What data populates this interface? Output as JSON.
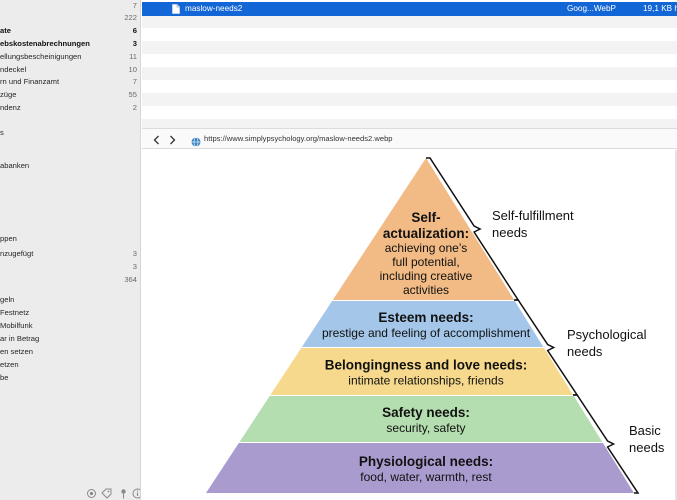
{
  "sidebar": {
    "items": [
      {
        "label": "",
        "count": "7",
        "bold": false
      },
      {
        "label": "",
        "count": "222",
        "bold": false
      },
      {
        "label": "ate",
        "count": "6",
        "bold": true
      },
      {
        "label": "ebskostenabrechnungen",
        "count": "3",
        "bold": true
      },
      {
        "label": "ellungsbescheinigungen",
        "count": "11",
        "bold": false
      },
      {
        "label": "ndeckel",
        "count": "10",
        "bold": false
      },
      {
        "label": "rn und Finanzamt",
        "count": "7",
        "bold": false
      },
      {
        "label": "züge",
        "count": "55",
        "bold": false
      },
      {
        "label": "ndenz",
        "count": "2",
        "bold": false
      },
      {
        "label": "",
        "count": "",
        "bold": false
      },
      {
        "label": "s",
        "count": "",
        "bold": false
      },
      {
        "label": "",
        "count": "",
        "bold": false
      },
      {
        "label": "",
        "count": "",
        "bold": false
      },
      {
        "label": "abanken",
        "count": "",
        "bold": false
      },
      {
        "label": "",
        "count": "",
        "bold": false
      },
      {
        "label": "",
        "count": "",
        "bold": false
      },
      {
        "label": "",
        "count": "",
        "bold": false
      },
      {
        "label": "",
        "count": "",
        "bold": false
      },
      {
        "label": "",
        "count": "",
        "bold": false
      },
      {
        "label": "ppen",
        "count": "",
        "bold": false
      },
      {
        "label": "nzugefügt",
        "count": "3",
        "bold": false
      },
      {
        "label": "",
        "count": "3",
        "bold": false
      },
      {
        "label": "",
        "count": "364",
        "bold": false
      },
      {
        "label": "",
        "count": "",
        "bold": false
      },
      {
        "label": "geln",
        "count": "",
        "bold": false
      },
      {
        "label": "Festnetz",
        "count": "",
        "bold": false
      },
      {
        "label": "Mobilfunk",
        "count": "",
        "bold": false
      },
      {
        "label": "ar in Betrag",
        "count": "",
        "bold": false
      },
      {
        "label": "en setzen",
        "count": "",
        "bold": false
      },
      {
        "label": "etzen",
        "count": "",
        "bold": false
      },
      {
        "label": "be",
        "count": "",
        "bold": false
      }
    ],
    "footer_icons": [
      "circle-icon",
      "tag-icon",
      "pin-icon",
      "info-icon"
    ]
  },
  "filelist": {
    "selected": {
      "name": "maslow-needs2",
      "kind": "Goog...WebP",
      "size": "19,1 KB h"
    }
  },
  "preview_bar": {
    "back_icon": "chevron-left-icon",
    "forward_icon": "chevron-right-icon",
    "url": "https://www.simplypsychology.org/maslow-needs2.webp"
  },
  "pyramid": {
    "levels": [
      {
        "title": "Physiological needs:",
        "subtitle": "food, water, warmth, rest",
        "color": "#a99bce"
      },
      {
        "title": "Safety needs:",
        "subtitle": "security, safety",
        "color": "#b4ddb0"
      },
      {
        "title": "Belongingness and love needs:",
        "subtitle": "intimate relationships, friends",
        "color": "#f6d98d"
      },
      {
        "title": "Esteem needs:",
        "subtitle": "prestige and feeling of accomplishment",
        "color": "#a3c6e9"
      },
      {
        "title_lines": [
          "Self-",
          "actualization:"
        ],
        "subtitle_lines": [
          "achieving one’s",
          "full potential,",
          "including creative",
          "activities"
        ],
        "color": "#f2ba84"
      }
    ],
    "brackets": [
      {
        "lines": [
          "Self-fulfillment",
          "needs"
        ]
      },
      {
        "lines": [
          "Psychological",
          "needs"
        ]
      },
      {
        "lines": [
          "Basic",
          "needs"
        ]
      }
    ]
  }
}
